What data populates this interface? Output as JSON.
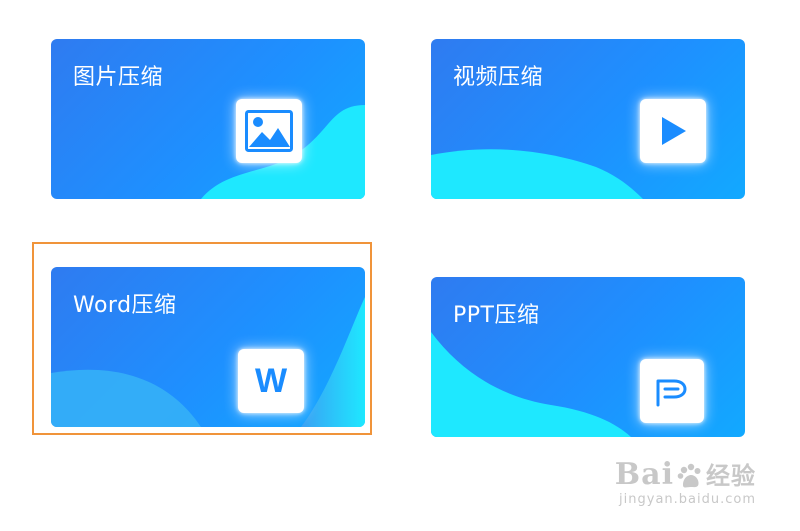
{
  "cards": {
    "image": {
      "title": "图片压缩",
      "icon": "image-icon"
    },
    "video": {
      "title": "视频压缩",
      "icon": "play-icon"
    },
    "word": {
      "title": "Word压缩",
      "icon": "word-icon",
      "letter": "W"
    },
    "ppt": {
      "title": "PPT压缩",
      "icon": "ppt-icon"
    }
  },
  "highlight": {
    "target": "word",
    "color": "#f0943a"
  },
  "watermark": {
    "brand": "Bai",
    "brand_suffix": "经验",
    "url": "jingyan.baidu.com"
  },
  "colors": {
    "card_gradient_start": "#2f7bf0",
    "card_gradient_end": "#12a9ff",
    "wave": "#1ee8ff",
    "icon_blue": "#1a8cff"
  }
}
